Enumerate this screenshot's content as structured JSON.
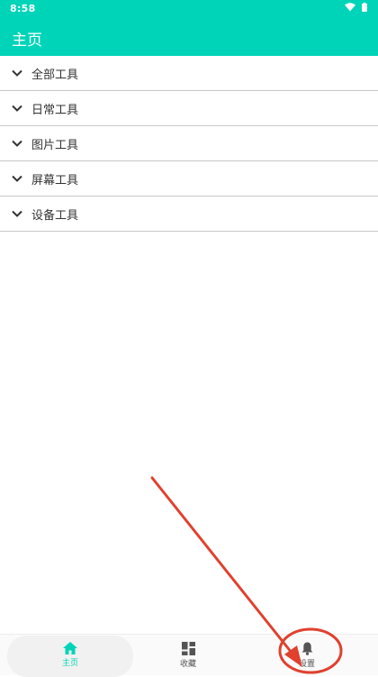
{
  "status_bar": {
    "time": "8:58"
  },
  "app_bar": {
    "title": "主页"
  },
  "categories": [
    {
      "label": "全部工具"
    },
    {
      "label": "日常工具"
    },
    {
      "label": "图片工具"
    },
    {
      "label": "屏幕工具"
    },
    {
      "label": "设备工具"
    }
  ],
  "bottom_nav": {
    "home_label": "主页",
    "favorites_label": "收藏",
    "settings_label": "设置",
    "active": "home"
  },
  "colors": {
    "accent": "#00d4b8",
    "annotation": "#e0412e"
  }
}
